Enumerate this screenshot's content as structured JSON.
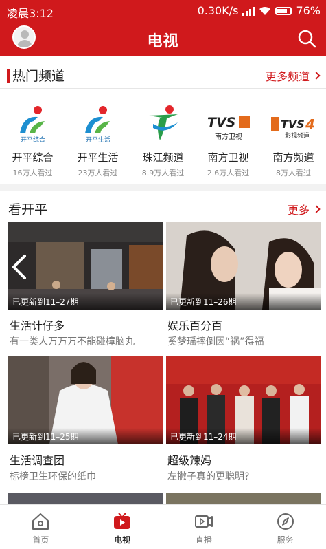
{
  "status_bar": {
    "time": "凌晨3:12",
    "network_speed": "0.30K/s",
    "battery": "76%"
  },
  "header": {
    "title": "电视",
    "avatar_icon": "user-avatar-icon",
    "search_icon": "search-icon"
  },
  "hot_channels": {
    "title": "热门频道",
    "more_label": "更多频道",
    "items": [
      {
        "name": "开平综合",
        "views": "16万人看过",
        "logo_text": "开平综合",
        "logo_icon": "kaiping-logo"
      },
      {
        "name": "开平生活",
        "views": "23万人看过",
        "logo_text": "开平生活",
        "logo_icon": "kaiping-logo"
      },
      {
        "name": "珠江频道",
        "views": "8.9万人看过",
        "logo_text": "",
        "logo_icon": "pearl-river-logo"
      },
      {
        "name": "南方卫视",
        "views": "2.6万人看过",
        "logo_text": "南方卫视",
        "logo_icon": "tvs-logo"
      },
      {
        "name": "南方频道",
        "views": "8万人看过",
        "logo_text": "影视频道",
        "logo_icon": "tvs4-logo"
      }
    ]
  },
  "watch_kaiping": {
    "title": "看开平",
    "more_label": "更多",
    "cards": [
      {
        "badge": "已更新到11–27期",
        "title": "生活计仔多",
        "desc": "有一类人万万万不能碰樟脑丸"
      },
      {
        "badge": "已更新到11–26期",
        "title": "娱乐百分百",
        "desc": "奚梦瑶摔倒因“祸”得福"
      },
      {
        "badge": "已更新到11–25期",
        "title": "生活调查团",
        "desc": "标榜卫生环保的纸巾"
      },
      {
        "badge": "已更新到11–24期",
        "title": "超级辣妈",
        "desc": "左撇子真的更聪明?"
      }
    ]
  },
  "bottom_nav": {
    "items": [
      {
        "label": "首页",
        "icon": "home-icon"
      },
      {
        "label": "电视",
        "icon": "tv-icon"
      },
      {
        "label": "直播",
        "icon": "live-video-icon"
      },
      {
        "label": "服务",
        "icon": "compass-icon"
      }
    ],
    "active": "电视"
  },
  "colors": {
    "brand_red": "#d0191c",
    "text_dark": "#222222",
    "text_muted": "#888888"
  }
}
